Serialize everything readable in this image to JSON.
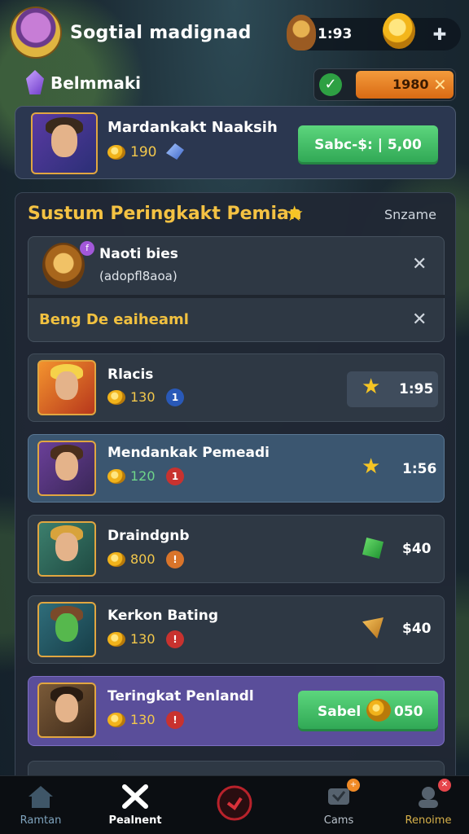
{
  "header": {
    "title": "Sogtial madignad",
    "resource_value": "1:93",
    "add_symbol": "✚"
  },
  "section": {
    "label": "Belmmaki",
    "toggle_value": "1980",
    "toggle_close": "✕"
  },
  "featured": {
    "name": "Mardankakt Naaksih",
    "coins": "190",
    "button_label": "Sabc-$: | 5,00"
  },
  "panel": {
    "title": "Sustum Peringkakt Pemian",
    "link": "Snzame",
    "notice": {
      "title": "Naoti bies",
      "subtitle": "(adopfl8aoa)",
      "highlight": "Beng De  eaiheaml",
      "close_symbol": "✕"
    },
    "rows": [
      {
        "name": "Rlacis",
        "coins": "130",
        "badge": "1",
        "rank": "1:95",
        "rank_icon": "★"
      },
      {
        "name": "Mendankak Pemeadi",
        "coins": "120",
        "badge": "1",
        "rank": "1:56",
        "rank_icon": "★"
      },
      {
        "name": "Draindgnb",
        "coins": "800",
        "badge": "!",
        "rank": "$40",
        "rank_icon": "green-gem"
      },
      {
        "name": "Kerkon Bating",
        "coins": "130",
        "badge": "!",
        "rank": "$40",
        "rank_icon": "orange-gem"
      },
      {
        "name": "Teringkat Penlandl",
        "coins": "130",
        "badge": "!",
        "button_label": "Sabel",
        "button_value": "050"
      }
    ]
  },
  "nav": {
    "items": [
      {
        "label": "Ramtan"
      },
      {
        "label": "Pealnent"
      },
      {
        "label": ""
      },
      {
        "label": "Cams"
      },
      {
        "label": "Renoime"
      }
    ]
  },
  "colors": {
    "accent_gold": "#f4c243",
    "button_green": "#2ea653",
    "highlight_blue": "#3b5670",
    "highlight_purple": "#5a4e9a"
  }
}
